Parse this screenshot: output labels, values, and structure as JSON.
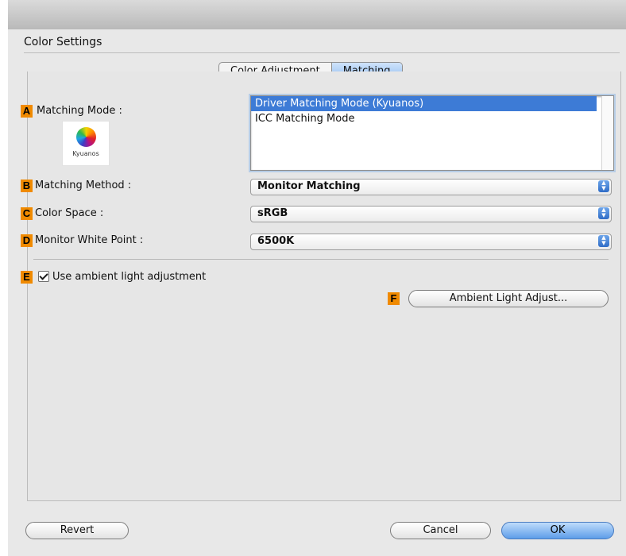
{
  "window": {
    "title": "Color Settings"
  },
  "tabs": [
    {
      "label": "Color Adjustment",
      "selected": false
    },
    {
      "label": "Matching",
      "selected": true
    }
  ],
  "badges": {
    "a": "A",
    "b": "B",
    "c": "C",
    "d": "D",
    "e": "E",
    "f": "F"
  },
  "matching_mode": {
    "label": "Matching Mode :",
    "logo_text": "Kyuanos",
    "options": [
      "Driver Matching Mode (Kyuanos)",
      "ICC Matching Mode"
    ],
    "selected_index": 0
  },
  "matching_method": {
    "label": "Matching Method :",
    "value": "Monitor Matching"
  },
  "color_space": {
    "label": "Color Space :",
    "value": "sRGB"
  },
  "white_point": {
    "label": "Monitor White Point :",
    "value": "6500K"
  },
  "ambient": {
    "checkbox_label": "Use ambient light adjustment",
    "checked": true,
    "button_label": "Ambient Light Adjust..."
  },
  "footer": {
    "revert": "Revert",
    "cancel": "Cancel",
    "ok": "OK"
  },
  "colors": {
    "badge": "#f08a00",
    "selection": "#3d7bd6",
    "accent": "#5e9de9"
  }
}
